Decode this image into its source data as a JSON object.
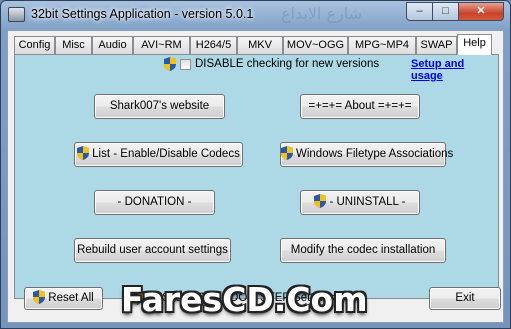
{
  "window": {
    "title": "32bit Settings Application - version 5.0.1",
    "bg_watermark": "شارع الابداع",
    "controls": {
      "minimize": "–",
      "maximize": "□",
      "close": "✕"
    }
  },
  "tabs": [
    {
      "label": "Config"
    },
    {
      "label": "Misc"
    },
    {
      "label": "Audio"
    },
    {
      "label": "AVI~RM"
    },
    {
      "label": "H264/5"
    },
    {
      "label": "MKV"
    },
    {
      "label": "MOV~OGG"
    },
    {
      "label": "MPG~MP4"
    },
    {
      "label": "SWAP"
    },
    {
      "label": "Help",
      "active": true
    }
  ],
  "help": {
    "disable_check_label": "DISABLE checking for new versions",
    "setup_link": "Setup and usage",
    "buttons": {
      "website": "Shark007's website",
      "about": "=+=+= About =+=+=",
      "codecs": "List - Enable/Disable Codecs",
      "filetype": "Windows Filetype Associations",
      "donation": "- DONATION -",
      "uninstall": "- UNINSTALL -",
      "rebuild": "Rebuild user account settings",
      "modify": "Modify the codec installation"
    }
  },
  "footer": {
    "reset_all": "Reset All",
    "settings_check_label": "Shark007's ZOOM STEP Settings",
    "exit": "Exit"
  },
  "watermark": "FaresCD.Com",
  "icons": {
    "uac_shield": "uac-shield-icon",
    "app": "app-icon"
  },
  "colors": {
    "panel_bg": "#add8e6",
    "link": "#0000ee"
  }
}
